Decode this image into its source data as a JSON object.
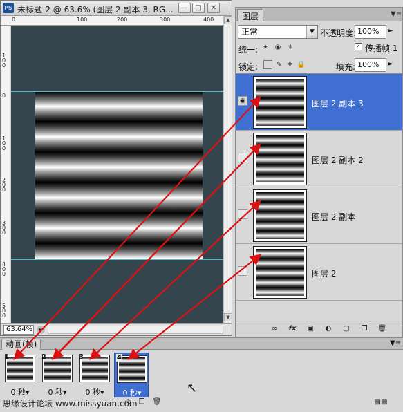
{
  "document": {
    "title": "未标题-2 @ 63.6% (图层 2 副本 3, RG...",
    "app_icon": "PS",
    "zoom": "63.64%",
    "ruler_h": [
      "0",
      "100",
      "200",
      "300",
      "400"
    ],
    "ruler_v": [
      "1\n0\n0",
      "0",
      "1\n0\n0",
      "2\n0\n0",
      "3\n0\n0",
      "4\n0\n0",
      "5\n0\n0"
    ]
  },
  "layers_panel": {
    "tab": "图层",
    "blend_mode": "正常",
    "opacity_label": "不透明度:",
    "opacity_value": "100%",
    "unify_label": "统一:",
    "propagate_label": "传播帧 1",
    "lock_label": "锁定:",
    "fill_label": "填充:",
    "fill_value": "100%",
    "layers": [
      {
        "name": "图层 2 副本 3",
        "selected": true
      },
      {
        "name": "图层 2 副本 2",
        "selected": false
      },
      {
        "name": "图层 2 副本",
        "selected": false
      },
      {
        "name": "图层 2",
        "selected": false
      }
    ]
  },
  "animation_panel": {
    "tab": "动画(帧)",
    "frames": [
      {
        "number": "1",
        "delay": "0 秒▾"
      },
      {
        "number": "2",
        "delay": "0 秒▾"
      },
      {
        "number": "3",
        "delay": "0 秒▾"
      },
      {
        "number": "4",
        "delay": "0 秒▾"
      }
    ],
    "watermark": "思缘设计论坛 www.missyuan.com"
  },
  "colors": {
    "selection": "#3f6fd0",
    "canvas_bg": "#35454d",
    "guide": "#36c6d6",
    "arrow": "#dd1111"
  }
}
